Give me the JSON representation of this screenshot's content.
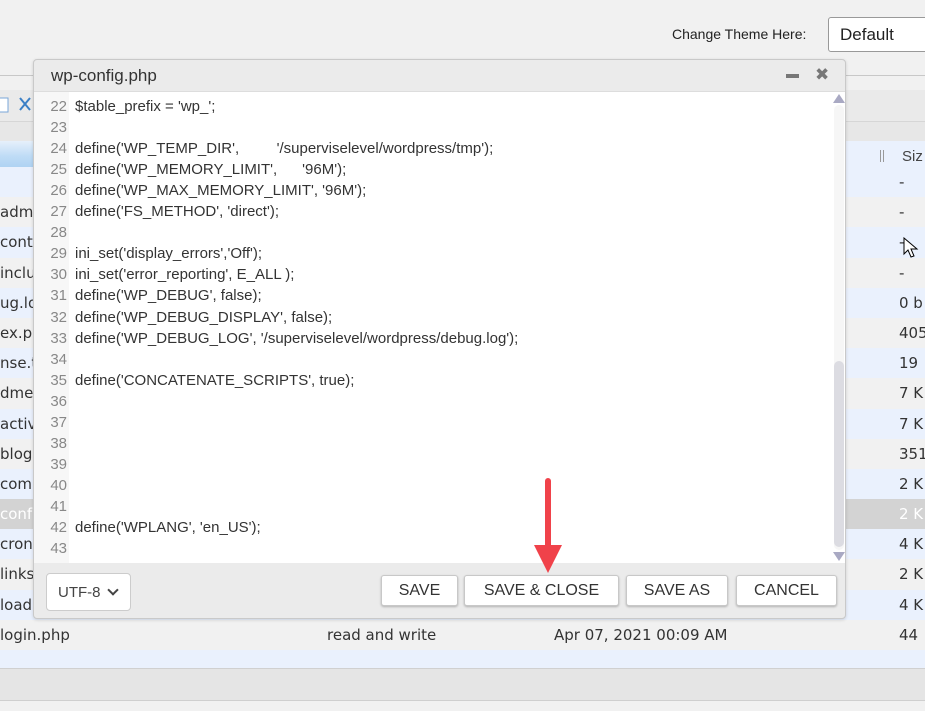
{
  "header": {
    "theme_label": "Change Theme Here:",
    "theme_value": "Default"
  },
  "file_manager": {
    "size_header": "Siz",
    "rows": [
      {
        "name": "",
        "perm": "",
        "date": "",
        "size": "-",
        "style": "alt"
      },
      {
        "name": "adm",
        "perm": "",
        "date": "",
        "size": "-",
        "style": ""
      },
      {
        "name": "cont",
        "perm": "",
        "date": "",
        "size": "-",
        "style": "alt"
      },
      {
        "name": "inclu",
        "perm": "",
        "date": "",
        "size": "-",
        "style": ""
      },
      {
        "name": "ug.lo",
        "perm": "",
        "date": "",
        "size": "0 b",
        "style": "alt"
      },
      {
        "name": "ex.ph",
        "perm": "",
        "date": "",
        "size": "405",
        "style": ""
      },
      {
        "name": "nse.t",
        "perm": "",
        "date": "",
        "size": "19",
        "style": "alt"
      },
      {
        "name": "dme.",
        "perm": "",
        "date": "",
        "size": "7 K",
        "style": ""
      },
      {
        "name": "activ",
        "perm": "",
        "date": "",
        "size": "7 K",
        "style": "alt"
      },
      {
        "name": "blog",
        "perm": "",
        "date": "",
        "size": "351",
        "style": ""
      },
      {
        "name": "com",
        "perm": "",
        "date": "",
        "size": "2 K",
        "style": "alt"
      },
      {
        "name": "conf",
        "perm": "",
        "date": "",
        "size": "2 K",
        "style": "sel"
      },
      {
        "name": "cron",
        "perm": "",
        "date": "",
        "size": "4 K",
        "style": "alt"
      },
      {
        "name": "links",
        "perm": "",
        "date": "",
        "size": "2 K",
        "style": ""
      },
      {
        "name": "load",
        "perm": "",
        "date": "",
        "size": "4 K",
        "style": "alt"
      },
      {
        "name": "login.php",
        "perm": "read and write",
        "date": "Apr 07, 2021 00:09 AM",
        "size": "44",
        "style": ""
      },
      {
        "name": "",
        "perm": "",
        "date": "",
        "size": "",
        "style": "alt"
      }
    ]
  },
  "dialog": {
    "title": "wp-config.php",
    "minimize_icon": "minimize-icon",
    "close_icon": "close-icon",
    "scroll_position": 0.55,
    "scroll_visible_fraction": 0.42,
    "lines": [
      {
        "n": "22",
        "code": "$table_prefix = 'wp_';"
      },
      {
        "n": "23",
        "code": ""
      },
      {
        "n": "24",
        "code": "define('WP_TEMP_DIR',         '/superviselevel/wordpress/tmp');"
      },
      {
        "n": "25",
        "code": "define('WP_MEMORY_LIMIT',      '96M');"
      },
      {
        "n": "26",
        "code": "define('WP_MAX_MEMORY_LIMIT', '96M');"
      },
      {
        "n": "27",
        "code": "define('FS_METHOD', 'direct');"
      },
      {
        "n": "28",
        "code": ""
      },
      {
        "n": "29",
        "code": "ini_set('display_errors','Off');"
      },
      {
        "n": "30",
        "code": "ini_set('error_reporting', E_ALL );"
      },
      {
        "n": "31",
        "code": "define('WP_DEBUG', false);"
      },
      {
        "n": "32",
        "code": "define('WP_DEBUG_DISPLAY', false);"
      },
      {
        "n": "33",
        "code": "define('WP_DEBUG_LOG', '/superviselevel/wordpress/debug.log');"
      },
      {
        "n": "34",
        "code": ""
      },
      {
        "n": "35",
        "code": "define('CONCATENATE_SCRIPTS', true);"
      },
      {
        "n": "36",
        "code": ""
      },
      {
        "n": "37",
        "code": ""
      },
      {
        "n": "38",
        "code": ""
      },
      {
        "n": "39",
        "code": ""
      },
      {
        "n": "40",
        "code": ""
      },
      {
        "n": "41",
        "code": ""
      },
      {
        "n": "42",
        "code": "define('WPLANG', 'en_US');"
      },
      {
        "n": "43",
        "code": ""
      }
    ],
    "encoding": "UTF-8",
    "buttons": {
      "save": "SAVE",
      "save_close": "SAVE & CLOSE",
      "save_as": "SAVE AS",
      "cancel": "CANCEL"
    }
  },
  "annotation": {
    "arrow_color": "#f0424a",
    "points_to": "SAVE & CLOSE"
  }
}
